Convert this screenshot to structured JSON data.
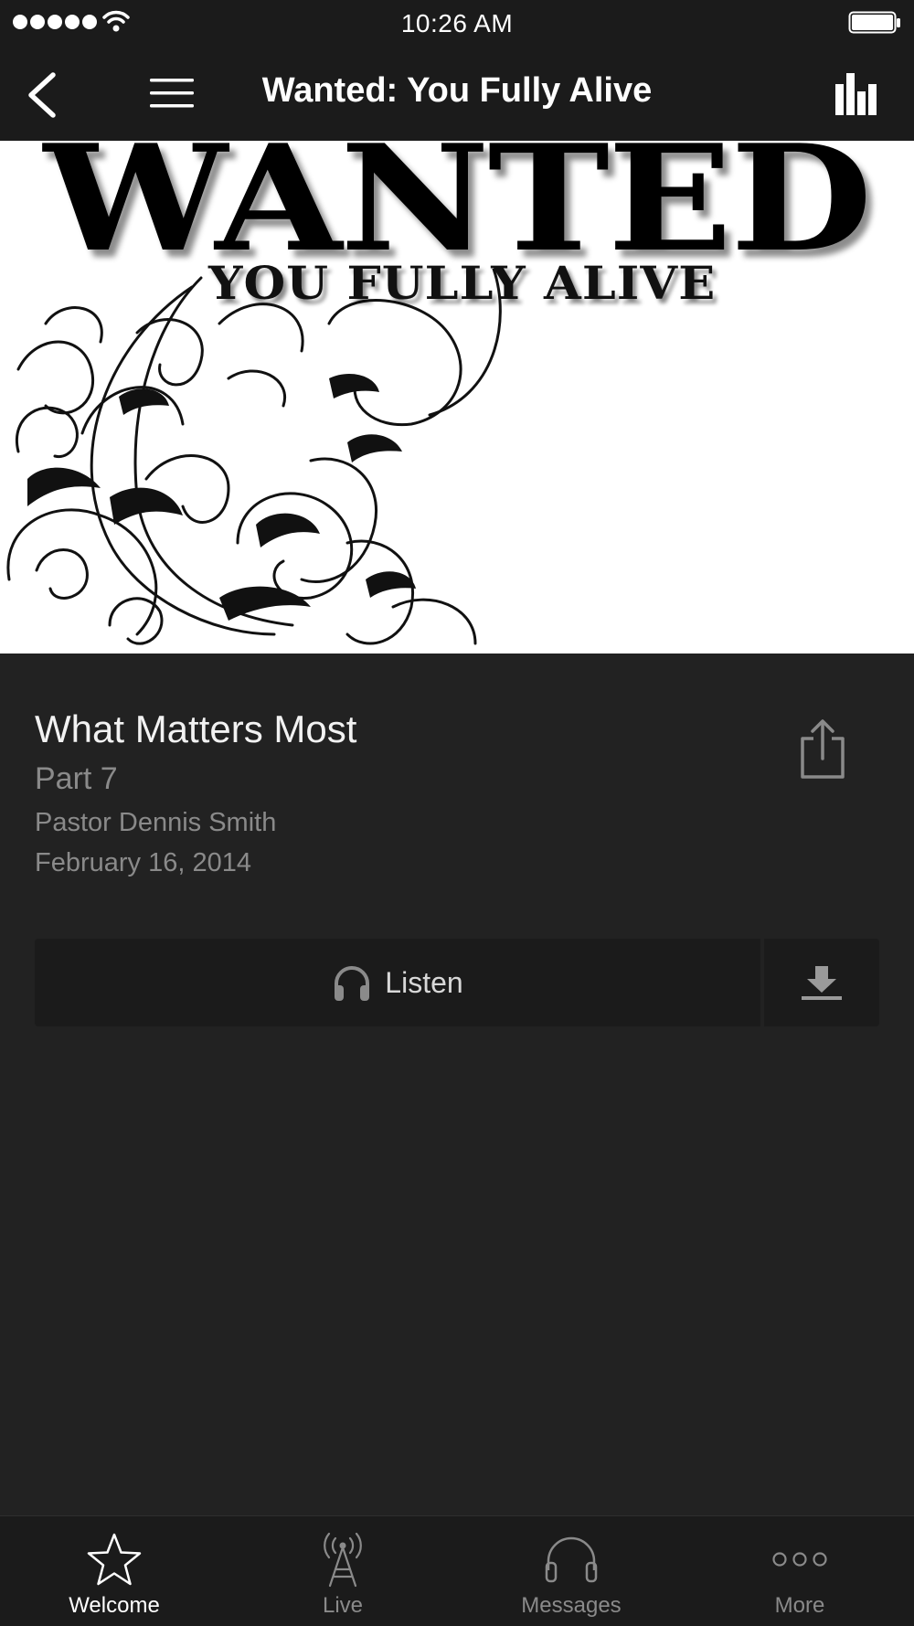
{
  "status_bar": {
    "time": "10:26 AM"
  },
  "nav": {
    "title": "Wanted: You Fully Alive"
  },
  "artwork": {
    "title": "WANTED",
    "subtitle": "YOU FULLY ALIVE"
  },
  "sermon": {
    "title": "What Matters Most",
    "part": "Part 7",
    "speaker": "Pastor Dennis Smith",
    "date": "February 16, 2014"
  },
  "actions": {
    "listen_label": "Listen"
  },
  "tabs": [
    {
      "label": "Welcome",
      "icon": "star-icon",
      "active": true
    },
    {
      "label": "Live",
      "icon": "broadcast-tower-icon",
      "active": false
    },
    {
      "label": "Messages",
      "icon": "headphones-icon",
      "active": false
    },
    {
      "label": "More",
      "icon": "more-dots-icon",
      "active": false
    }
  ],
  "colors": {
    "background": "#222222",
    "bar": "#1b1b1b",
    "secondary_text": "#8a8a8a",
    "primary_text": "#ffffff"
  }
}
